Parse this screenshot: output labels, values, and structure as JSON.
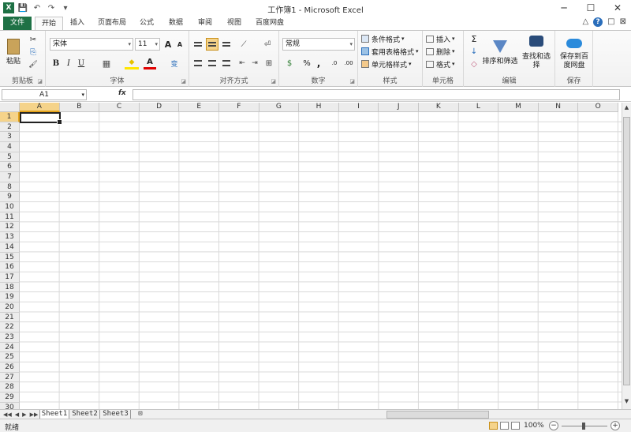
{
  "window": {
    "title": "工作簿1 - Microsoft Excel",
    "app_icon": "X",
    "qat": [
      "save-icon",
      "undo-icon",
      "redo-icon",
      "customize-icon"
    ],
    "qat_glyphs": [
      "💾",
      "↶",
      "↷",
      "▾"
    ],
    "controls": [
      "─",
      "☐",
      "✕"
    ]
  },
  "tabs": {
    "file": "文件",
    "items": [
      "开始",
      "插入",
      "页面布局",
      "公式",
      "数据",
      "审阅",
      "视图",
      "百度网盘"
    ],
    "active": "开始",
    "right_icons": [
      "△",
      "?",
      "□",
      "⊠"
    ]
  },
  "ribbon": {
    "clipboard": {
      "label": "剪贴板",
      "paste": "粘贴",
      "cut": "✂",
      "copy": "⎘",
      "format_painter": "🖌"
    },
    "font": {
      "label": "字体",
      "name": "宋体",
      "size": "11",
      "grow": "A",
      "shrink": "A",
      "bold": "B",
      "italic": "I",
      "underline": "U",
      "border": "▦",
      "fill": "◆",
      "color": "A",
      "phonetic": "变"
    },
    "alignment": {
      "label": "对齐方式"
    },
    "number": {
      "label": "数字",
      "format": "常规",
      "currency": "$",
      "percent": "%",
      "comma": ",",
      "inc": ".0",
      "dec": ".00"
    },
    "styles": {
      "label": "样式",
      "conditional": "条件格式",
      "table": "套用表格格式",
      "cell": "单元格样式"
    },
    "cells": {
      "label": "单元格",
      "insert": "插入",
      "delete": "删除",
      "format": "格式"
    },
    "editing": {
      "label": "编辑",
      "sum": "Σ",
      "fill": "↓",
      "clear": "◇",
      "sort": "排序和筛选",
      "find": "查找和选择"
    },
    "save": {
      "label": "保存",
      "save_to_baidu_line1": "保存到百",
      "save_to_baidu_line2": "度网盘"
    }
  },
  "formula_bar": {
    "name_box": "A1",
    "fx": "fx",
    "value": ""
  },
  "grid": {
    "columns": [
      "A",
      "B",
      "C",
      "D",
      "E",
      "F",
      "G",
      "H",
      "I",
      "J",
      "K",
      "L",
      "M",
      "N",
      "O"
    ],
    "rows": [
      "1",
      "2",
      "3",
      "4",
      "5",
      "6",
      "7",
      "8",
      "9",
      "10",
      "11",
      "12",
      "13",
      "14",
      "15",
      "16",
      "17",
      "18",
      "19",
      "20",
      "21",
      "22",
      "23",
      "24",
      "25",
      "26",
      "27",
      "28",
      "29",
      "30"
    ],
    "active_cell": "A1"
  },
  "sheets": {
    "tabs": [
      "Sheet1",
      "Sheet2",
      "Sheet3"
    ],
    "active": "Sheet1",
    "nav": [
      "◀◀",
      "◀",
      "▶",
      "▶▶"
    ]
  },
  "status": {
    "ready": "就绪",
    "zoom": "100%",
    "zoom_level": 1.0,
    "minus": "−",
    "plus": "+"
  }
}
